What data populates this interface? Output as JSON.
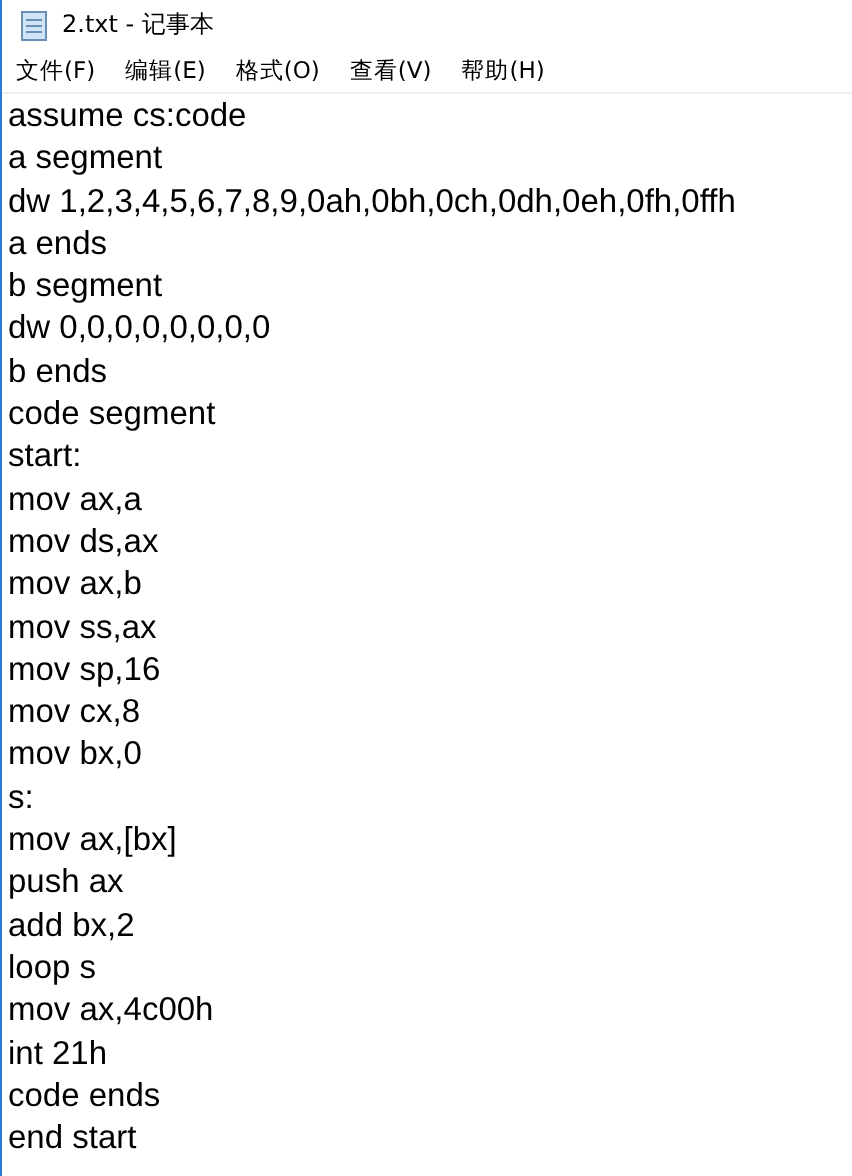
{
  "window": {
    "title": "2.txt - 记事本"
  },
  "menu": [
    "文件(F)",
    "编辑(E)",
    "格式(O)",
    "查看(V)",
    "帮助(H)"
  ],
  "editor": {
    "lines": [
      "assume cs:code",
      "a segment",
      "dw 1,2,3,4,5,6,7,8,9,0ah,0bh,0ch,0dh,0eh,0fh,0ffh",
      "a ends",
      "b segment",
      "dw 0,0,0,0,0,0,0,0",
      "b ends",
      "code segment",
      "start:",
      "mov ax,a",
      "mov ds,ax",
      "mov ax,b",
      "mov ss,ax",
      "mov sp,16",
      "mov cx,8",
      "mov bx,0",
      "s:",
      "mov ax,[bx]",
      "push ax",
      "add bx,2",
      "loop s",
      "mov ax,4c00h",
      "int 21h",
      "code ends",
      "end start"
    ]
  }
}
